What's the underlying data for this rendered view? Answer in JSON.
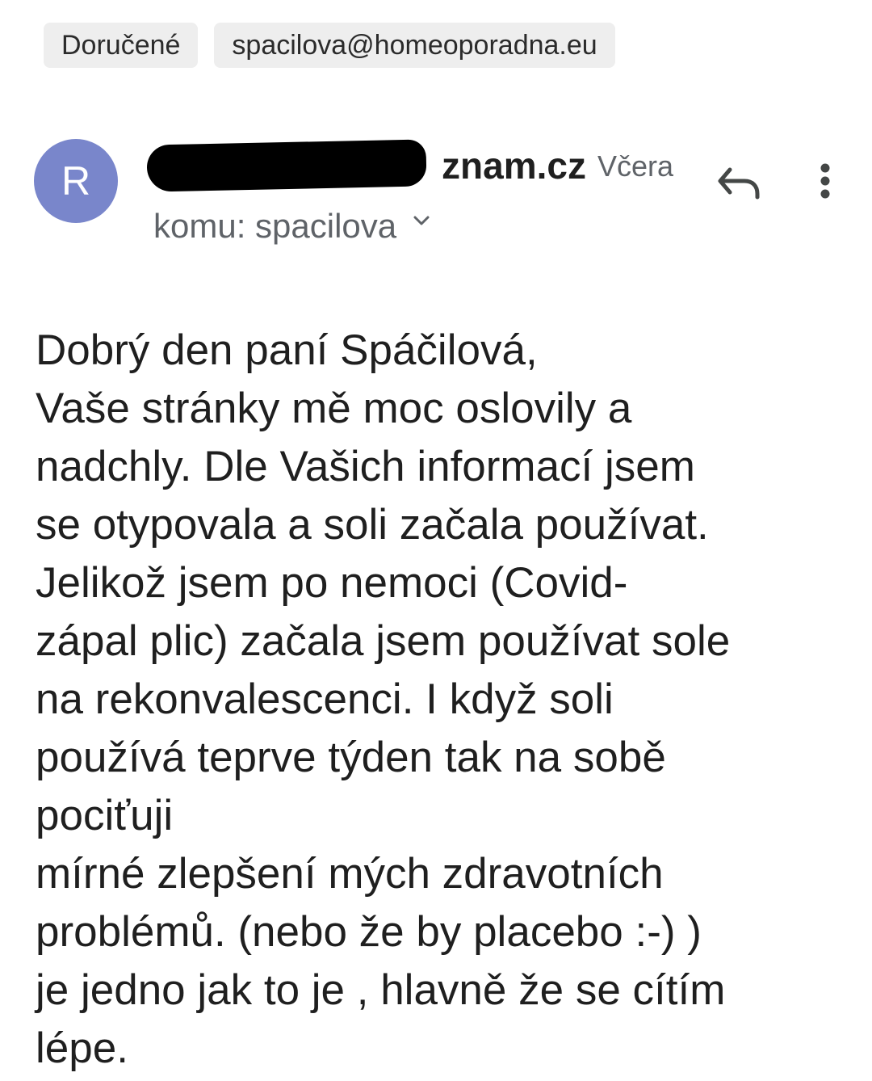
{
  "labels": [
    "Doručené",
    "spacilova@homeoporadna.eu"
  ],
  "message": {
    "avatar_initial": "R",
    "sender_visible": "znam.cz",
    "date": "Včera",
    "recipient": "komu: spacilova",
    "body_lines": [
      "Dobrý den paní Spáčilová,",
      "Vaše stránky mě moc oslovily a",
      "nadchly.  Dle Vašich informací jsem",
      "se otypovala a soli začala používat.",
      "Jelikož jsem po nemoci (Covid-",
      "zápal plic) začala jsem používat sole",
      "na rekonvalescenci. I když soli",
      "používá teprve týden tak na sobě",
      "pociťuji",
      "mírné zlepšení mých zdravotních",
      "problémů. (nebo že by placebo :-) )",
      "je jedno jak to je , hlavně že se cítím",
      "lépe."
    ]
  },
  "colors": {
    "avatar_bg": "#7986cb",
    "chip_bg": "#eeeeee",
    "secondary_text": "#5f6368"
  },
  "icons": {
    "reply": "reply-icon",
    "more": "more-vert-icon",
    "expand": "chevron-down-icon"
  }
}
